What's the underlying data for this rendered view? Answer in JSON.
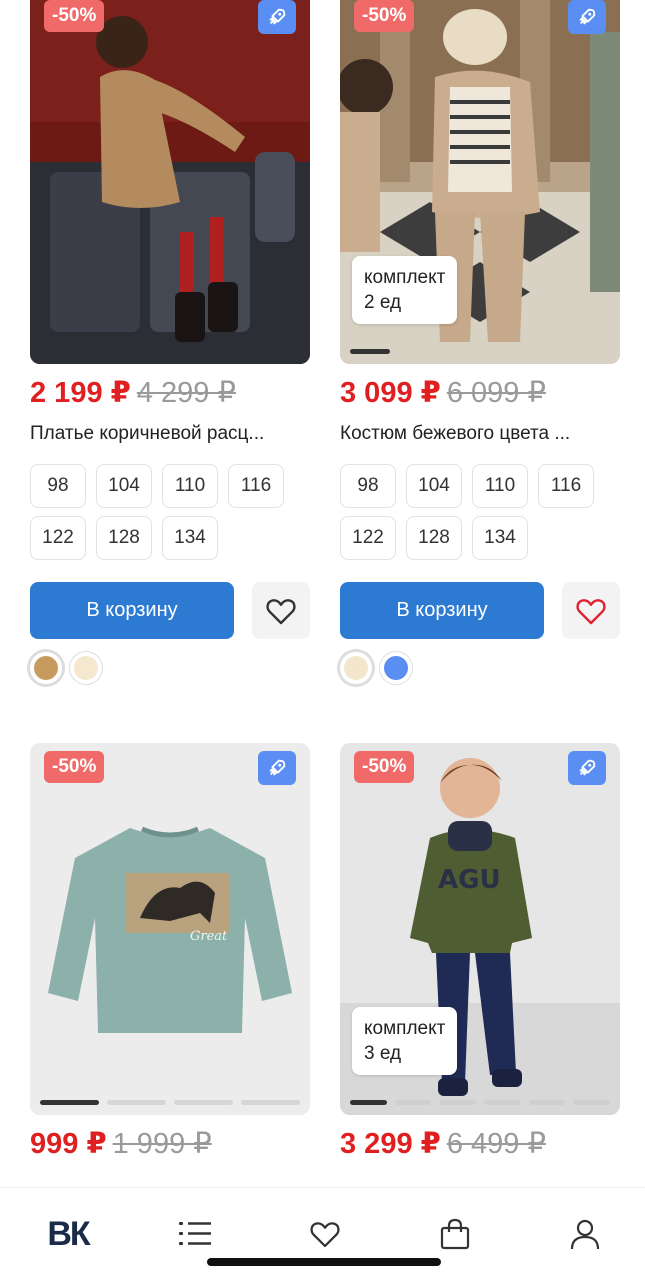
{
  "products": [
    {
      "discount": "-50%",
      "price_new": "2 199 ₽",
      "price_old": "4 299 ₽",
      "name": "Платье коричневой расц...",
      "sizes": [
        "98",
        "104",
        "110",
        "116",
        "122",
        "128",
        "134"
      ],
      "cart_label": "В корзину",
      "kit": null,
      "colors": [
        "#c79a5e",
        "#f5e8cf"
      ],
      "fav_color": "#333333"
    },
    {
      "discount": "-50%",
      "price_new": "3 099 ₽",
      "price_old": "6 099 ₽",
      "name": "Костюм бежевого цвета ...",
      "sizes": [
        "98",
        "104",
        "110",
        "116",
        "122",
        "128",
        "134"
      ],
      "cart_label": "В корзину",
      "kit": {
        "line1": "комплект",
        "line2": "2 ед"
      },
      "colors": [
        "#f2e6cc",
        "#5b8ef2"
      ],
      "fav_color": "#e02030"
    },
    {
      "discount": "-50%",
      "price_new": "999 ₽",
      "price_old": "1 999 ₽",
      "kit": null
    },
    {
      "discount": "-50%",
      "price_new": "3 299 ₽",
      "price_old": "6 499 ₽",
      "kit": {
        "line1": "комплект",
        "line2": "3 ед"
      }
    }
  ],
  "tabbar": {
    "logo": "ВК",
    "icons": [
      "logo-icon",
      "catalog-list-icon",
      "favorites-heart-icon",
      "cart-bag-icon",
      "profile-icon"
    ]
  },
  "colors": {
    "accent": "#2d7ad2",
    "price_red": "#e02020",
    "discount_badge": "#f06a6a",
    "rocket_badge": "#5b8ef2"
  }
}
